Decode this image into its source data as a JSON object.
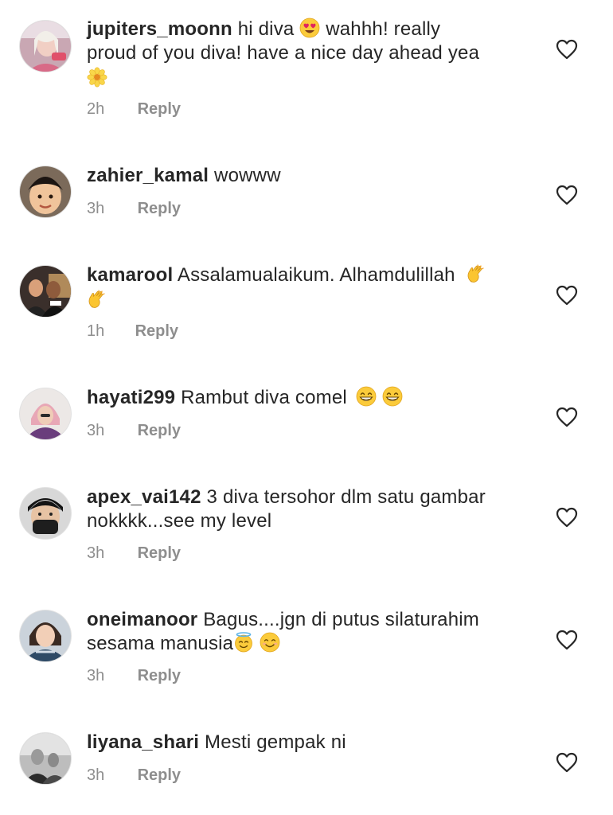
{
  "comments": [
    {
      "username": "jupiters_moonn",
      "text_parts": [
        "hi diva ",
        "[heart-eyes]",
        " wahhh! really proud of you diva! have a nice day ahead yea ",
        "[sunflower]"
      ],
      "text_a": "hi diva",
      "text_b": "wahhh! really",
      "text_c": "proud of you diva! have a nice day ahead yea",
      "time": "2h",
      "reply_label": "Reply",
      "emojis": [
        "smiling-face-with-heart-eyes",
        "blossom"
      ]
    },
    {
      "username": "zahier_kamal",
      "text": "wowww",
      "time": "3h",
      "reply_label": "Reply"
    },
    {
      "username": "kamarool",
      "text": "Assalamualaikum. Alhamdulillah",
      "time": "1h",
      "reply_label": "Reply",
      "emojis": [
        "clapping-hands",
        "clapping-hands"
      ]
    },
    {
      "username": "hayati299",
      "text": "Rambut diva comel",
      "time": "3h",
      "reply_label": "Reply",
      "emojis": [
        "grinning-face",
        "grinning-face"
      ]
    },
    {
      "username": "apex_vai142",
      "text_line1": "3 diva tersohor dlm satu gambar",
      "text_line2": "nokkkk...see my level",
      "time": "3h",
      "reply_label": "Reply"
    },
    {
      "username": "oneimanoor",
      "text_line1": "Bagus....jgn di putus silaturahim",
      "text_line2": "sesama manusia",
      "time": "3h",
      "reply_label": "Reply",
      "emojis": [
        "smiling-face-with-halo",
        "smiling-face"
      ]
    },
    {
      "username": "liyana_shari",
      "text": "Mesti gempak ni",
      "time": "3h",
      "reply_label": "Reply"
    }
  ],
  "colors": {
    "text": "#262626",
    "meta": "#8e8e8e",
    "background": "#ffffff"
  },
  "icons": {
    "like": "heart-outline-icon"
  }
}
